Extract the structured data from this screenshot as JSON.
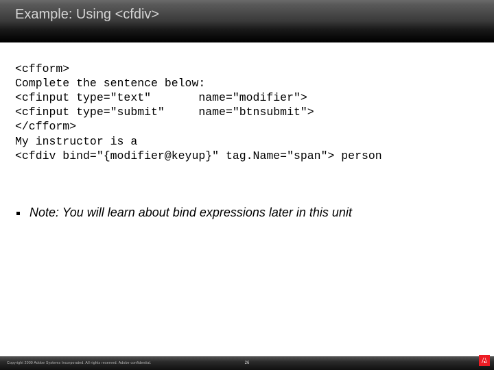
{
  "title": "Example: Using <cfdiv>",
  "code": "<cfform>\nComplete the sentence below:\n<cfinput type=\"text\"       name=\"modifier\">\n<cfinput type=\"submit\"     name=\"btnsubmit\">\n</cfform>\nMy instructor is a\n<cfdiv bind=\"{modifier@keyup}\" tag.Name=\"span\"> person",
  "note": "Note: You will learn about bind expressions later in this unit",
  "footer": {
    "copyright": "Copyright 2009 Adobe Systems Incorporated.  All rights reserved.  Adobe confidential.",
    "page": "26"
  }
}
